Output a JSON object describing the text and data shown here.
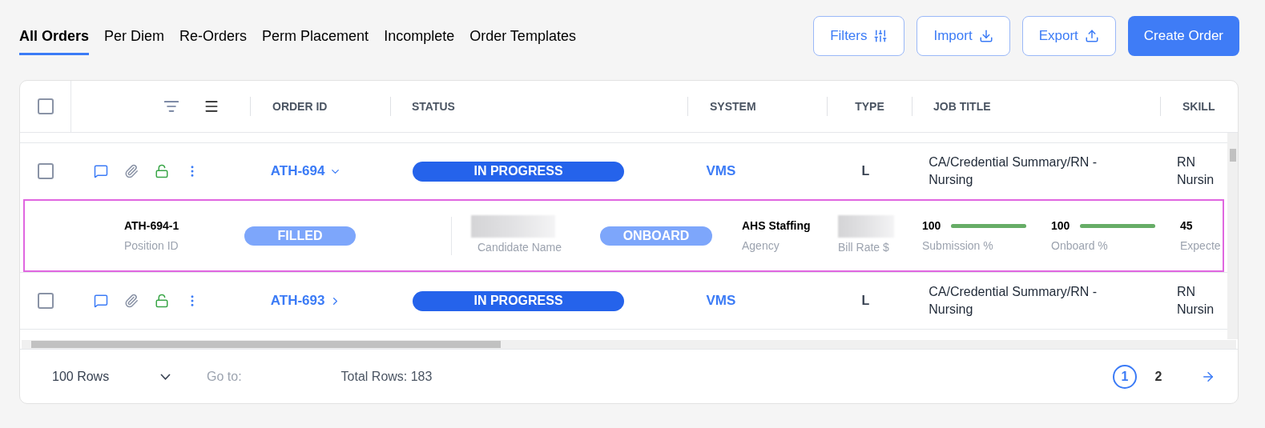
{
  "tabs": [
    {
      "label": "All Orders",
      "selected": true
    },
    {
      "label": "Per Diem",
      "selected": false
    },
    {
      "label": "Re-Orders",
      "selected": false
    },
    {
      "label": "Perm Placement",
      "selected": false
    },
    {
      "label": "Incomplete",
      "selected": false
    },
    {
      "label": "Order Templates",
      "selected": false
    }
  ],
  "actions": [
    {
      "label": "Filters",
      "kind": "filters"
    },
    {
      "label": "Import",
      "kind": "import"
    },
    {
      "label": "Export",
      "kind": "export"
    },
    {
      "label": "Create Order",
      "kind": "primary"
    }
  ],
  "table": {
    "select_all": {
      "checked": false
    },
    "columns": [
      "ORDER ID",
      "STATUS",
      "SYSTEM",
      "TYPE",
      "JOB TITLE",
      "SKILL"
    ],
    "rows": [
      {
        "checked": false,
        "order_id": "ATH-694",
        "expanded": true,
        "status": "IN PROGRESS",
        "system": "VMS",
        "type": "L",
        "job_title": "CA/Credential Summary/RN - Nursing",
        "skill": "RN Nursin",
        "detail": {
          "position_id": "ATH-694-1",
          "position_label": "Position ID",
          "position_status": "FILLED",
          "candidate_label": "Candidate Name",
          "candidate_status": "ONBOARD",
          "agency": "AHS Staffing",
          "agency_label": "Agency",
          "bill_rate_label": "Bill Rate $",
          "meters": [
            {
              "value": "100",
              "label": "Submission %",
              "level": 1
            },
            {
              "value": "100",
              "label": "Onboard %",
              "level": 1
            }
          ],
          "expected": "45",
          "expected_label": "Expecte"
        }
      },
      {
        "checked": false,
        "order_id": "ATH-693",
        "expanded": false,
        "status": "IN PROGRESS",
        "system": "VMS",
        "type": "L",
        "job_title": "CA/Credential Summary/RN - Nursing",
        "skill": "RN Nursin"
      }
    ]
  },
  "footer": {
    "rows_per_page": "100 Rows",
    "goto_label": "Go to:",
    "total": "Total Rows: 183",
    "pages": [
      {
        "label": "1",
        "selected": true
      },
      {
        "label": "2",
        "selected": false
      }
    ]
  }
}
